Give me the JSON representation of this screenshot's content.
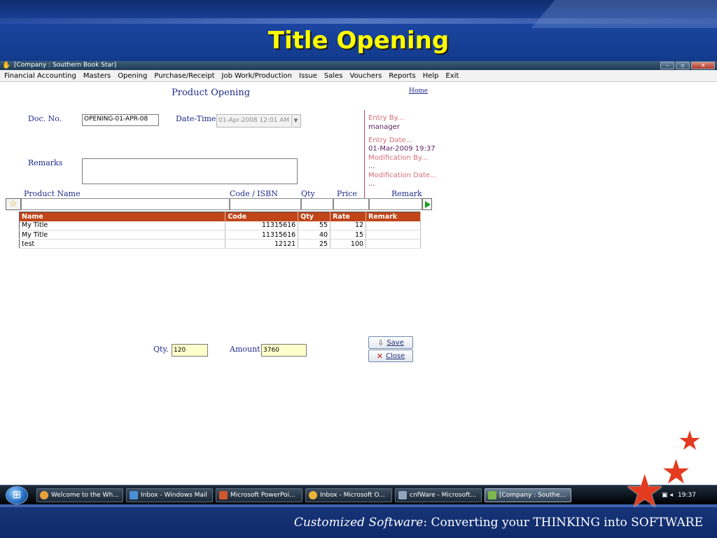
{
  "slide": {
    "title": "Title Opening",
    "tagline_italic": "Customized Software",
    "tagline_rest": ":   Converting your THINKING into SOFTWARE"
  },
  "window": {
    "title": "[Company : Southern Book Star]"
  },
  "menu": [
    "Financial Accounting",
    "Masters",
    "Opening",
    "Purchase/Receipt",
    "Job Work/Production",
    "Issue",
    "Sales",
    "Vouchers",
    "Reports",
    "Help",
    "Exit"
  ],
  "form": {
    "heading": "Product Opening",
    "home_link": "Home",
    "doc_no_label": "Doc. No.",
    "doc_no_value": "OPENING-01-APR-08",
    "datetime_label": "Date-Time",
    "datetime_value": "01-Apr-2008 12:01 AM",
    "remarks_label": "Remarks",
    "remarks_value": "",
    "entry_by_label": "Entry  By...",
    "entry_by_value": "manager",
    "entry_date_label": "Entry  Date...",
    "entry_date_value": "01-Mar-2009 19:37",
    "mod_by_label": "Modification  By...",
    "mod_by_value": "...",
    "mod_date_label": "Modification  Date...",
    "mod_date_value": "...",
    "entry_headers": {
      "product_name": "Product Name",
      "code": "Code / ISBN",
      "qty": "Qty",
      "price": "Price",
      "remark": "Remark"
    },
    "grid": {
      "columns": [
        "Name",
        "Code",
        "Qty",
        "Rate",
        "Remark"
      ],
      "rows": [
        {
          "name": "My Title",
          "code": "11315616",
          "qty": "55",
          "rate": "12",
          "remark": ""
        },
        {
          "name": "My Title",
          "code": "11315616",
          "qty": "40",
          "rate": "15",
          "remark": ""
        },
        {
          "name": "test",
          "code": "12121",
          "qty": "25",
          "rate": "100",
          "remark": ""
        }
      ]
    },
    "qty_label": "Qty.",
    "qty_value": "120",
    "amount_label": "Amount",
    "amount_value": "3760",
    "save_label": "Save",
    "close_label": "Close"
  },
  "taskbar": {
    "items": [
      {
        "label": "Welcome to the Wh...",
        "color": "#e9a03b"
      },
      {
        "label": "Inbox - Windows Mail",
        "color": "#4a8fd6"
      },
      {
        "label": "Microsoft PowerPoi...",
        "color": "#d2572a"
      },
      {
        "label": "Inbox - Microsoft O...",
        "color": "#e8b43a"
      },
      {
        "label": "cnfWare - Microsoft...",
        "color": "#8fa4bd"
      },
      {
        "label": "[Company : Southe...",
        "color": "#7bb84a"
      }
    ],
    "time": "19:37"
  },
  "colors": {
    "title_yellow": "#ffff00",
    "grid_header": "#c0461a",
    "form_label": "#1f2a8c",
    "star_red": "#e23b1f"
  }
}
